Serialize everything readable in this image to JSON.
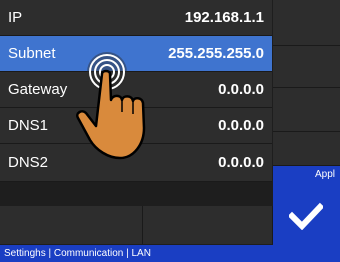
{
  "fields": [
    {
      "label": "IP",
      "value": "192.168.1.1"
    },
    {
      "label": "Subnet",
      "value": "255.255.255.0"
    },
    {
      "label": "Gateway",
      "value": "0.0.0.0"
    },
    {
      "label": "DNS1",
      "value": "0.0.0.0"
    },
    {
      "label": "DNS2",
      "value": "0.0.0.0"
    }
  ],
  "apply": {
    "label": "Appl"
  },
  "statusbar": {
    "breadcrumb": "Settinghs | Communication | LAN"
  },
  "colors": {
    "selected_row": "#3f74cf",
    "accent": "#1a3ec3",
    "row_bg": "#2d2d2d"
  },
  "icons": {
    "apply": "checkmark-icon",
    "gesture": "tap-hand-icon"
  }
}
